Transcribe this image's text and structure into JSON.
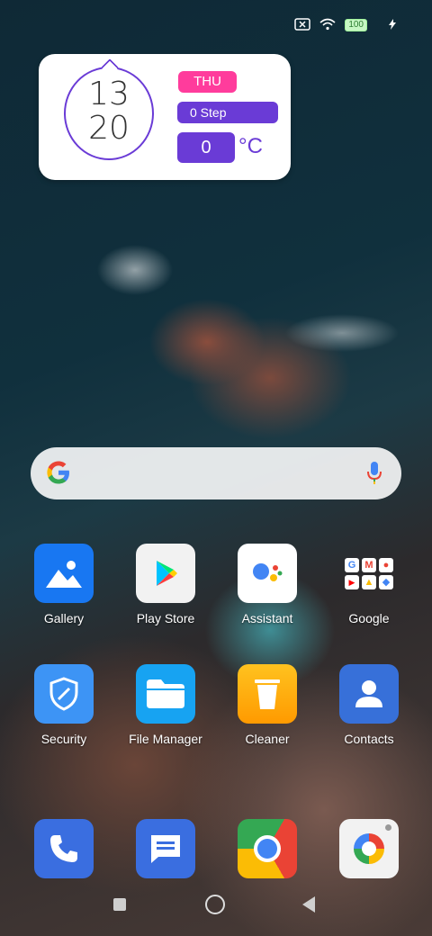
{
  "status_bar": {
    "battery": "100",
    "icons": [
      "sim-off-icon",
      "wifi-icon",
      "battery-icon",
      "charging-icon"
    ]
  },
  "widget": {
    "hour": "13",
    "minute": "20",
    "day": "THU",
    "steps": "0 Step",
    "temperature": "0",
    "unit": "°C"
  },
  "search": {
    "icons": [
      "google-logo-icon",
      "microphone-icon"
    ]
  },
  "apps_row1": [
    {
      "label": "Gallery",
      "icon": "gallery-icon"
    },
    {
      "label": "Play Store",
      "icon": "play-store-icon"
    },
    {
      "label": "Assistant",
      "icon": "assistant-icon"
    },
    {
      "label": "Google",
      "icon": "google-folder-icon"
    }
  ],
  "apps_row2": [
    {
      "label": "Security",
      "icon": "security-icon"
    },
    {
      "label": "File Manager",
      "icon": "folder-icon"
    },
    {
      "label": "Cleaner",
      "icon": "trash-icon"
    },
    {
      "label": "Contacts",
      "icon": "contacts-icon"
    }
  ],
  "dock": [
    {
      "icon": "phone-icon"
    },
    {
      "icon": "messages-icon"
    },
    {
      "icon": "chrome-icon"
    },
    {
      "icon": "camera-icon"
    }
  ],
  "colors": {
    "widget_purple": "#6a3bd6",
    "widget_pink": "#ff3c9c"
  }
}
